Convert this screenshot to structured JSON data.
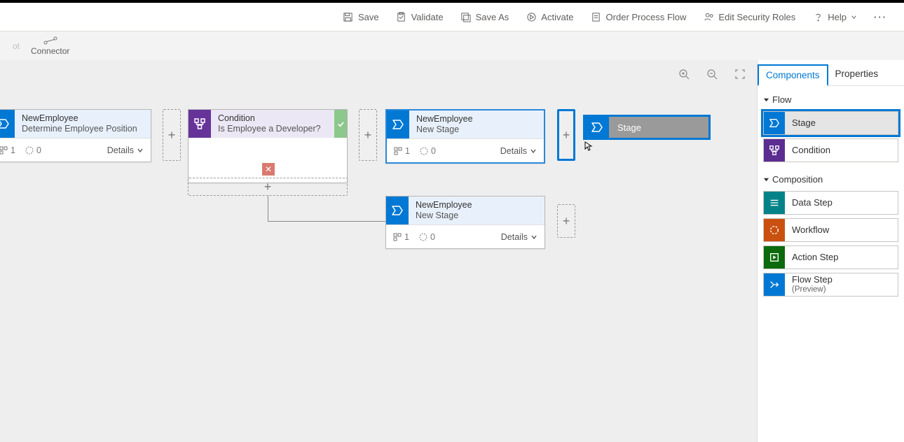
{
  "commands": {
    "save": "Save",
    "validate": "Validate",
    "save_as": "Save As",
    "activate": "Activate",
    "order": "Order Process Flow",
    "security": "Edit Security Roles",
    "help": "Help"
  },
  "sub_toolbar": {
    "cut_ghost": "ot",
    "connector": "Connector"
  },
  "canvas": {
    "stage1": {
      "entity": "NewEmployee",
      "name": "Determine Employee Position",
      "steps": "1",
      "duration": "0",
      "details": "Details"
    },
    "condition": {
      "label": "Condition",
      "question": "Is Employee a Developer?"
    },
    "stage2": {
      "entity": "NewEmployee",
      "name": "New Stage",
      "steps": "1",
      "duration": "0",
      "details": "Details"
    },
    "stage3": {
      "entity": "NewEmployee",
      "name": "New Stage",
      "steps": "1",
      "duration": "0",
      "details": "Details"
    },
    "drag_label": "Stage"
  },
  "panel": {
    "tab_components": "Components",
    "tab_properties": "Properties",
    "group_flow": "Flow",
    "group_composition": "Composition",
    "items": {
      "stage": "Stage",
      "condition": "Condition",
      "data_step": "Data Step",
      "workflow": "Workflow",
      "action_step": "Action Step",
      "flow_step": "Flow Step",
      "flow_step_sub": "(Preview)"
    }
  }
}
